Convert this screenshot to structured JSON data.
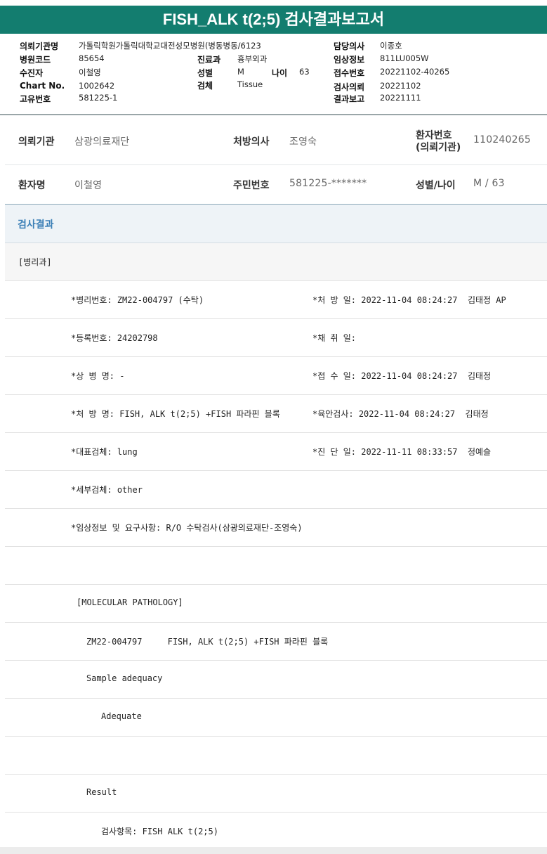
{
  "title": "FISH_ALK t(2;5) 검사결과보고서",
  "header": {
    "fields": [
      {
        "key": "의뢰기관명",
        "value": "가톨릭학원가톨릭대학교대전성모병원(병동병동/6123"
      },
      {
        "key": "병원코드",
        "value": "85654"
      },
      {
        "key": "수진자",
        "value": "이철영"
      },
      {
        "key": "Chart No.",
        "value": "1002642"
      },
      {
        "key": "고유번호",
        "value": "581225-1"
      },
      {
        "key": "진료과",
        "value": "흉부외과"
      },
      {
        "key": "성별",
        "value": "M"
      },
      {
        "key": "나이",
        "value": "63"
      },
      {
        "key": "검체",
        "value": "Tissue"
      },
      {
        "key": "담당의사",
        "value": "이종호"
      },
      {
        "key": "임상정보",
        "value": "811LU005W"
      },
      {
        "key": "접수번호",
        "value": "20221102-40265"
      },
      {
        "key": "검사의뢰",
        "value": "20221102"
      },
      {
        "key": "결과보고",
        "value": "20221111"
      }
    ]
  },
  "info": {
    "institution_label": "의뢰기관",
    "institution": "삼광의료재단",
    "doctor_label": "처방의사",
    "doctor": "조영숙",
    "patient_no_label_1": "환자번호",
    "patient_no_label_2": "(의뢰기관)",
    "patient_no": "110240265",
    "patient_name_label": "환자명",
    "patient_name": "이철영",
    "rrn_label": "주민번호",
    "rrn": "581225-*******",
    "sex_age_label": "성별/나이",
    "sex_age": "M / 63"
  },
  "section_title": "검사결과",
  "report": {
    "dept": "[병리과]",
    "lines": [
      {
        "left": "*병리번호: ZM22-004797 (수탁)",
        "right": "*처 방 일: 2022-11-04 08:24:27  김태정 AP"
      },
      {
        "left": "*등록번호: 24202798",
        "right": "*채 취 일:"
      },
      {
        "left": "*상 병 명: -",
        "right": "*접 수 일: 2022-11-04 08:24:27  김태정"
      },
      {
        "left": "*처 방 명: FISH, ALK t(2;5) +FISH 파라핀 블록",
        "right": "*육안검사: 2022-11-04 08:24:27  김태정"
      },
      {
        "left": "*대표검체: lung",
        "right": "*진 단 일: 2022-11-11 08:33:57  정예슬"
      },
      {
        "left": "*세부검체: other",
        "right": ""
      },
      {
        "left": "*임상정보 및 요구사항: R/O 수탁검사(삼광의료재단-조영숙)",
        "right": ""
      }
    ],
    "molecular": "[MOLECULAR PATHOLOGY]",
    "order_line": "ZM22-004797     FISH, ALK t(2;5) +FISH 파라핀 블록",
    "adequacy_label": "Sample adequacy",
    "adequacy_value": "Adequate",
    "result_label": "Result",
    "test_item": "검사항목: FISH ALK t(2;5)"
  }
}
